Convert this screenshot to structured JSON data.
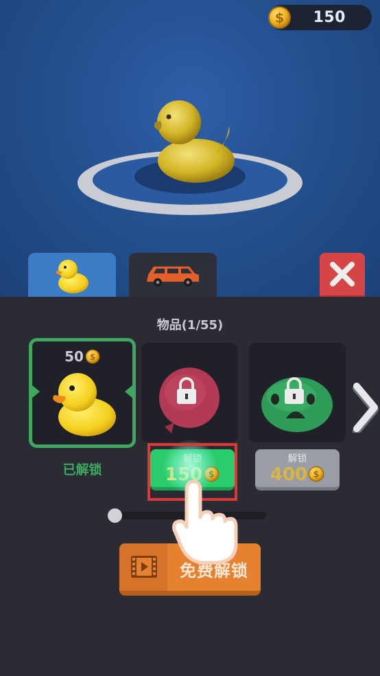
{
  "currency": {
    "coins": "150",
    "icon": "gold-dollar-coin"
  },
  "preview": {
    "item": "rubber-duck"
  },
  "tabs": [
    {
      "name": "rubber-duck-tab",
      "active": true
    },
    {
      "name": "suv-car-tab",
      "active": false
    }
  ],
  "panel": {
    "title": "物品(1/55)"
  },
  "items": [
    {
      "price": "50",
      "status": "已解锁",
      "locked": false
    },
    {
      "locked": true,
      "unlock_label": "解锁",
      "unlock_price": "150"
    },
    {
      "locked": true,
      "unlock_label": "解锁",
      "unlock_price": "400"
    }
  ],
  "free_unlock": {
    "label": "免费解锁",
    "icon": "video-film-icon"
  },
  "colors": {
    "green": "#3fa762",
    "button_green": "#2bcc6b",
    "orange": "#e6812f",
    "red": "#d64545",
    "gold": "#f6e56a"
  }
}
